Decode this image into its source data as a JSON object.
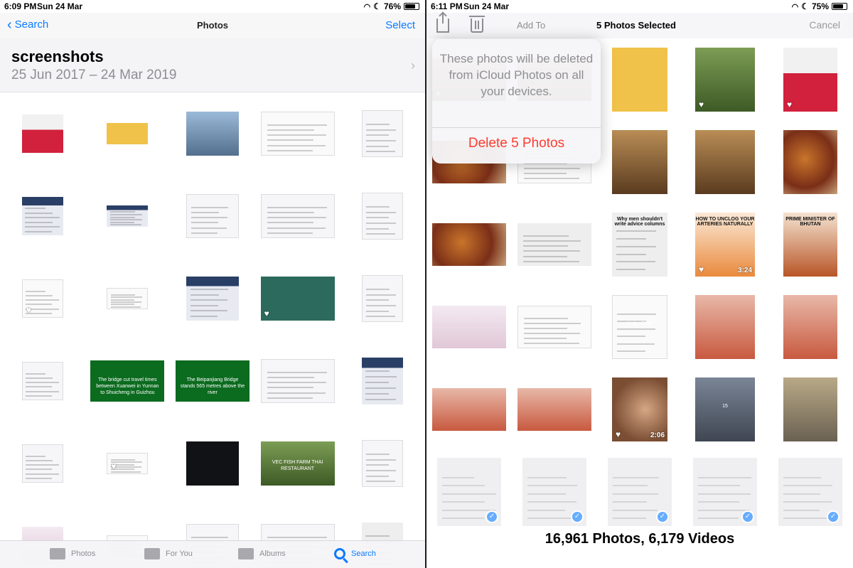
{
  "left": {
    "status": {
      "time": "6:09 PM",
      "date": "Sun 24 Mar",
      "battery": "76%",
      "battery_level": 0.76
    },
    "nav": {
      "back_label": "Search",
      "title": "Photos",
      "select_label": "Select"
    },
    "album": {
      "title": "screenshots",
      "range": "25 Jun 2017 – 24 Mar 2019"
    },
    "rows": [
      [
        "t-red",
        "t-yellow",
        "t-sky",
        "t-white",
        "t-ss"
      ],
      [
        "t-blue",
        "t-blue",
        "t-ss",
        "t-ss",
        "t-ss"
      ],
      [
        "t-white",
        "t-white",
        "t-blue",
        "t-teal",
        "t-ss"
      ],
      [
        "t-ss",
        "t-green",
        "t-green",
        "t-ss",
        "t-blue"
      ],
      [
        "t-ss",
        "t-white",
        "t-dark",
        "t-forest",
        "t-ss"
      ],
      [
        "t-pink",
        "t-white",
        "t-ss",
        "t-ss",
        "t-paper"
      ]
    ],
    "hearts": [
      [
        2,
        0
      ],
      [
        2,
        3
      ],
      [
        4,
        1
      ]
    ],
    "green_caption": "The bridge cut travel times between Xuanwei in Yunnan to Shuicheng in Guizhou",
    "green_caption2": "The Beipanjiang Bridge stands 565 metres above the river",
    "fish_caption": "VEC FISH FARM THAI RESTAURANT",
    "tabs": [
      {
        "label": "Photos",
        "icon": "photos-icon"
      },
      {
        "label": "For You",
        "icon": "for-you-icon"
      },
      {
        "label": "Albums",
        "icon": "albums-icon"
      },
      {
        "label": "Search",
        "icon": "search-icon"
      }
    ]
  },
  "right": {
    "status": {
      "time": "6:11 PM",
      "date": "Sun 24 Mar",
      "battery": "75%",
      "battery_level": 0.75
    },
    "nav": {
      "add_to_label": "Add To",
      "title": "5 Photos Selected",
      "cancel_label": "Cancel"
    },
    "sheet": {
      "message": "These photos will be deleted from iCloud Photos on all your devices.",
      "delete_label": "Delete 5 Photos"
    },
    "rows": [
      [
        "t-room",
        "t-room",
        "t-yellow",
        "t-forest",
        "t-red"
      ],
      [
        "t-food",
        "t-white",
        "t-room",
        "t-room",
        "t-food"
      ],
      [
        "t-food",
        "t-paper",
        "t-paper",
        "t-arteries",
        "t-bhutan"
      ],
      [
        "t-pink",
        "t-white",
        "t-white",
        "t-hall",
        "t-hall"
      ],
      [
        "t-hall",
        "t-hall",
        "t-skin",
        "t-parking",
        "t-parking2"
      ],
      [
        "t-selected",
        "t-selected",
        "t-selected",
        "t-selected",
        "t-selected"
      ]
    ],
    "hearts": [
      [
        0,
        0
      ],
      [
        0,
        1
      ],
      [
        0,
        3
      ],
      [
        0,
        4
      ],
      [
        2,
        3
      ],
      [
        4,
        2
      ]
    ],
    "durations": [
      {
        "row": 2,
        "col": 3,
        "text": "3:24"
      },
      {
        "row": 4,
        "col": 2,
        "text": "2:06"
      }
    ],
    "checked": [
      [
        5,
        0
      ],
      [
        5,
        1
      ],
      [
        5,
        2
      ],
      [
        5,
        3
      ],
      [
        5,
        4
      ]
    ],
    "advice_caption": "Why men shouldn't write advice columns",
    "arteries_caption": "HOW TO UNCLOG YOUR ARTERIES NATURALLY",
    "bhutan_caption": "PRIME MINISTER OF BHUTAN",
    "ajahn_caption": "Ajahn Chah",
    "parking_caption": "15",
    "counts": "16,961 Photos, 6,179 Videos"
  }
}
